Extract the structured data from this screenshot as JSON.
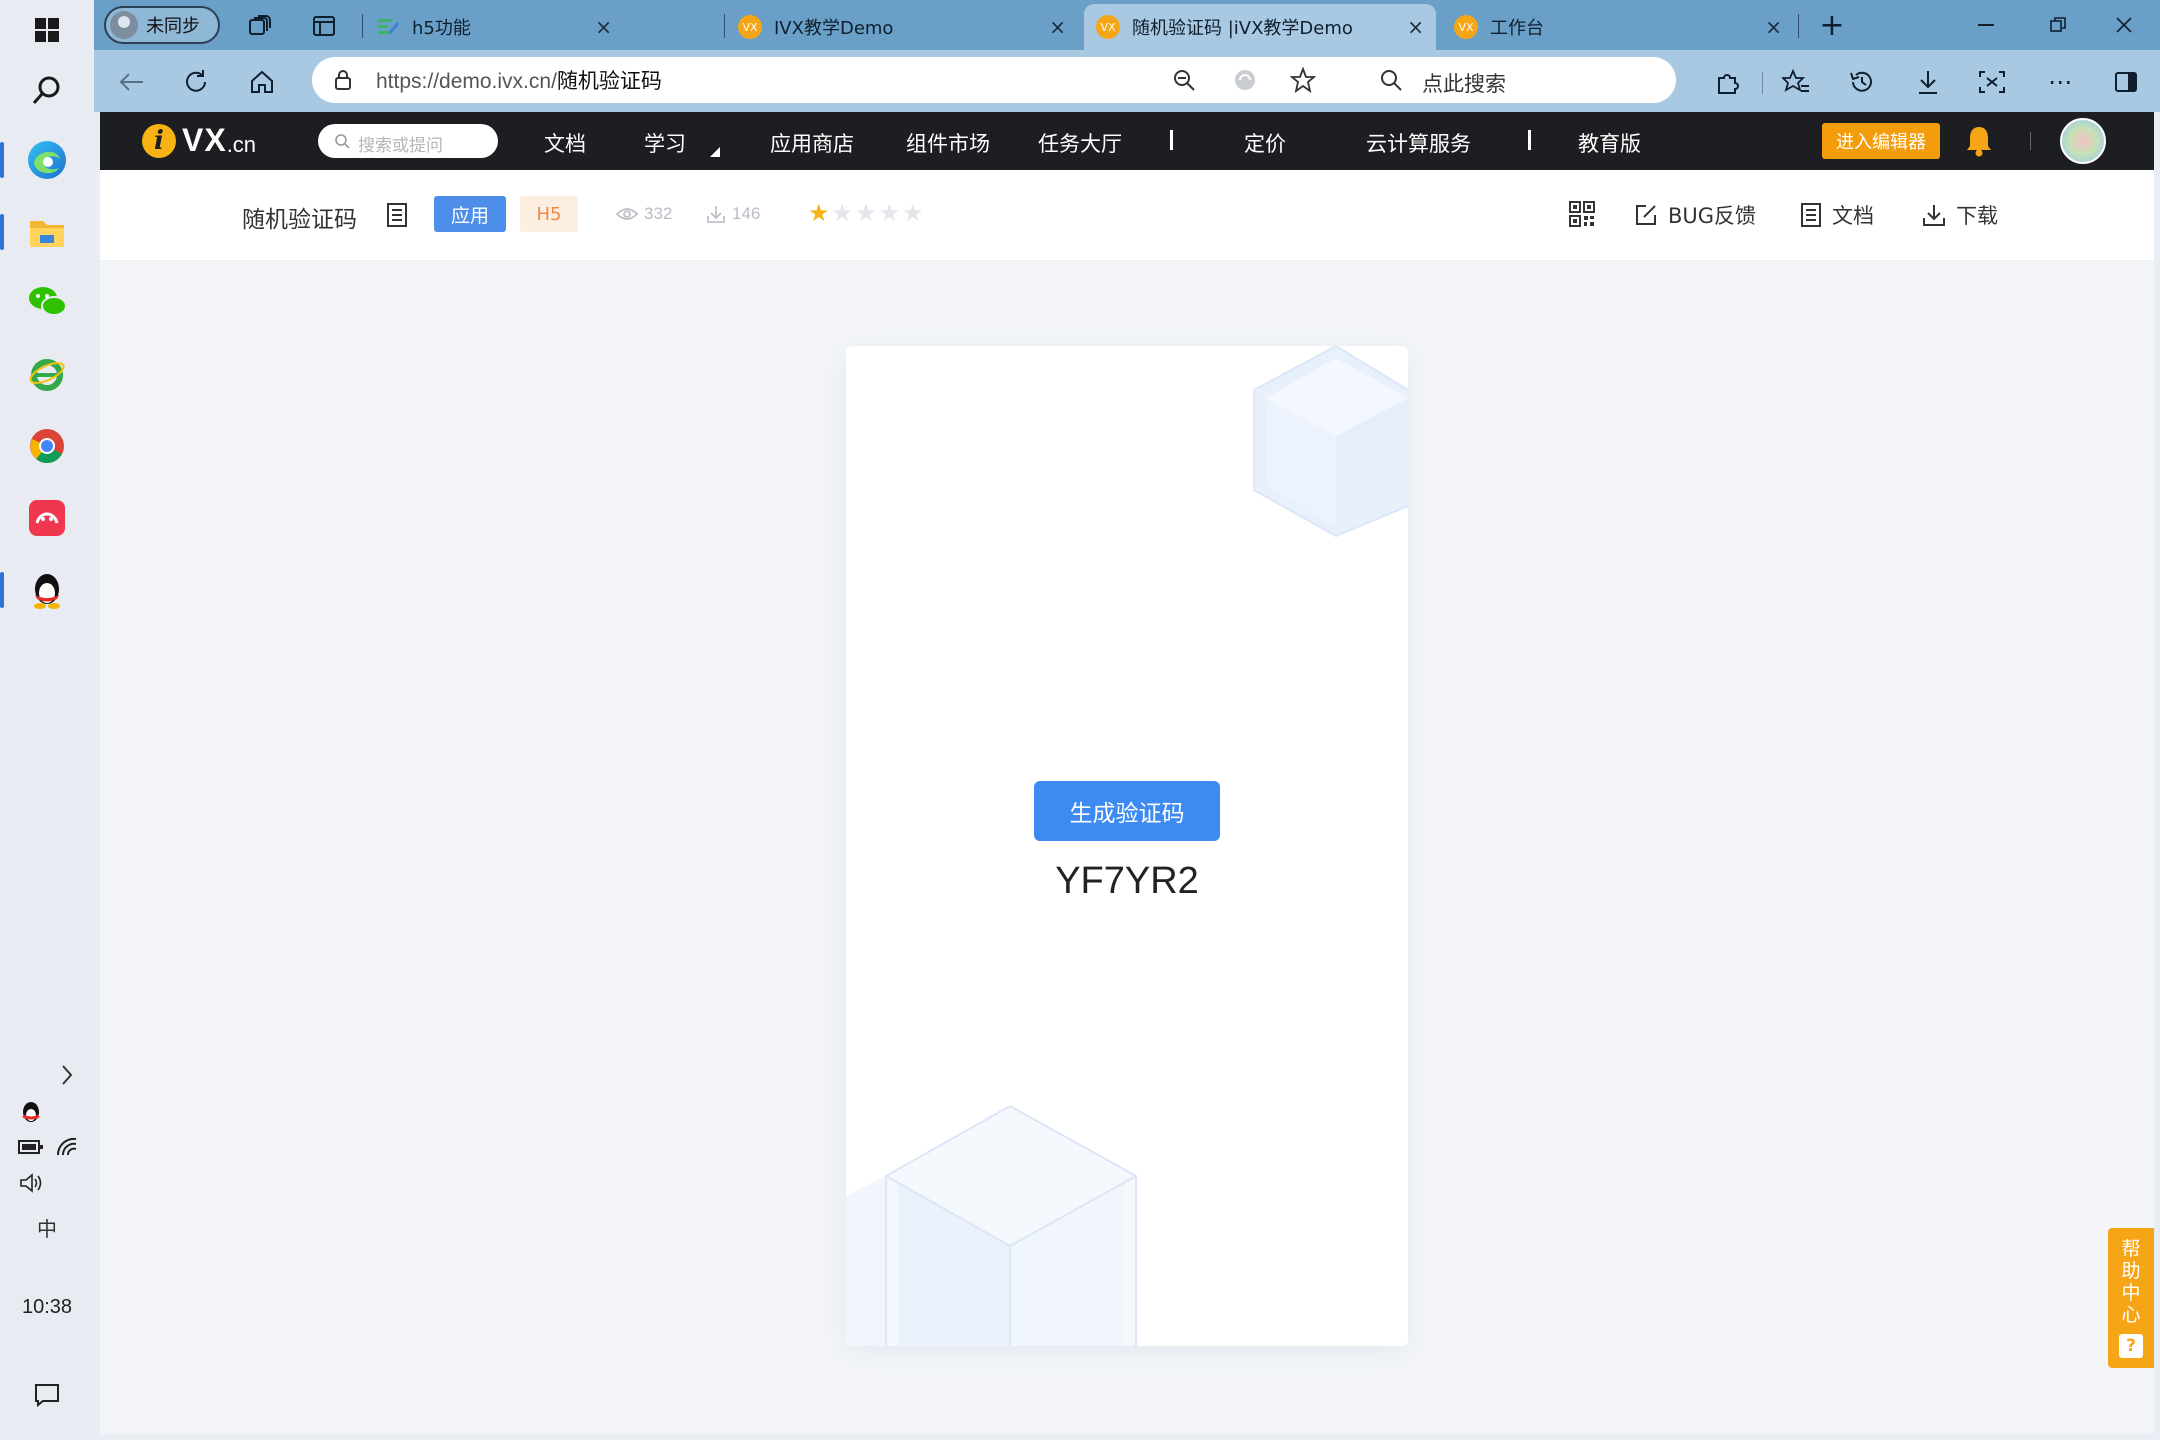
{
  "taskbar": {
    "clock": "10:38",
    "ime_label": "中",
    "icons": [
      "windows-start-icon",
      "search-icon",
      "edge-icon",
      "file-explorer-icon",
      "wechat-icon",
      "ie-icon",
      "chrome-icon",
      "app-red-icon",
      "qq-icon"
    ]
  },
  "browser": {
    "profile_label": "未同步",
    "tabs": [
      {
        "title": "h5功能",
        "favicon_color": "#3bb36b"
      },
      {
        "title": "IVX教学Demo",
        "favicon_color": "#f6a516"
      },
      {
        "title": "随机验证码 |iVX教学Demo",
        "favicon_color": "#f6a516",
        "active": true
      },
      {
        "title": "工作台",
        "favicon_color": "#f6a516"
      }
    ],
    "tab_close": "×",
    "new_tab": "+",
    "url_host": "https://demo.ivx.cn/",
    "url_path": "随机验证码",
    "search_placeholder": "点此搜索"
  },
  "ivx_nav": {
    "logo_i": "i",
    "logo_vx": "VX",
    "logo_cn": ".cn",
    "search_placeholder": "搜索或提问",
    "links": [
      "文档",
      "学习",
      "应用商店",
      "组件市场",
      "任务大厅",
      "定价",
      "云计算服务",
      "教育版"
    ],
    "editor_button": "进入编辑器"
  },
  "app_header": {
    "title": "随机验证码",
    "tag_app": "应用",
    "tag_h5": "H5",
    "views": "332",
    "downloads": "146",
    "rating": 1,
    "rating_max": 5,
    "actions": {
      "bug": "BUG反馈",
      "docs": "文档",
      "download": "下载"
    }
  },
  "preview": {
    "generate_button": "生成验证码",
    "code": "YF7YR2"
  },
  "help_center": {
    "chars": [
      "帮",
      "助",
      "中",
      "心"
    ],
    "q": "?"
  },
  "colors": {
    "accent_blue": "#3d8bf2",
    "ivx_orange": "#f39c0c",
    "nav_bg": "#1d1e22",
    "tab_bar": "#6aa0c8"
  }
}
